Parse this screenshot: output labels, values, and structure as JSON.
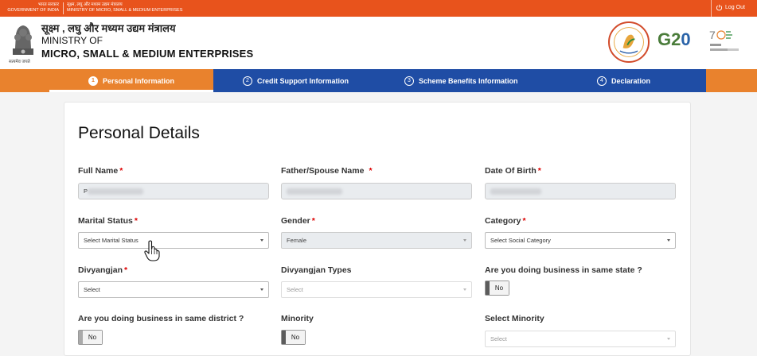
{
  "topbar": {
    "gov_hindi": "भारत सरकार",
    "gov_english": "GOVERNMENT OF INDIA",
    "ministry_hindi": "सूक्ष्म, लघु और मध्यम उद्यम मंत्रालय",
    "ministry_english": "MINISTRY OF MICRO, SMALL & MEDIUM ENTERPRISES",
    "logout_label": "Log Out"
  },
  "header": {
    "emblem_caption": "सत्यमेव जयते",
    "hindi_title": "सूक्ष्म , लघु और मध्यम उद्यम मंत्रालय",
    "ministry_of": "MINISTRY OF",
    "ministry_name": "MICRO, SMALL & MEDIUM ENTERPRISES",
    "g20_left": "G2",
    "g20_right": "0"
  },
  "steps": [
    {
      "num": "1",
      "label": "Personal Information"
    },
    {
      "num": "2",
      "label": "Credit Support Information"
    },
    {
      "num": "3",
      "label": "Scheme Benefits Information"
    },
    {
      "num": "4",
      "label": "Declaration"
    }
  ],
  "form": {
    "title": "Personal Details",
    "full_name_label": "Full Name",
    "full_name_prefix": "P",
    "father_label": "Father/Spouse Name",
    "dob_label": "Date Of Birth",
    "marital_label": "Marital Status",
    "marital_value": "Select Marital Status",
    "gender_label": "Gender",
    "gender_value": "Female",
    "category_label": "Category",
    "category_value": "Select Social Category",
    "divyangjan_label": "Divyangjan",
    "divyangjan_value": "Select",
    "divyangjan_types_label": "Divyangjan Types",
    "divyangjan_types_value": "Select",
    "same_state_label": "Are you doing business in same state ?",
    "same_state_value": "No",
    "same_district_label": "Are you doing business in same district ?",
    "same_district_value": "No",
    "minority_label": "Minority",
    "minority_value": "No",
    "select_minority_label": "Select Minority",
    "select_minority_value": "Select",
    "required_mark": "*"
  },
  "colors": {
    "topbar": "#e8531c",
    "steps_orange": "#e9822d",
    "steps_blue": "#1f4da5"
  }
}
